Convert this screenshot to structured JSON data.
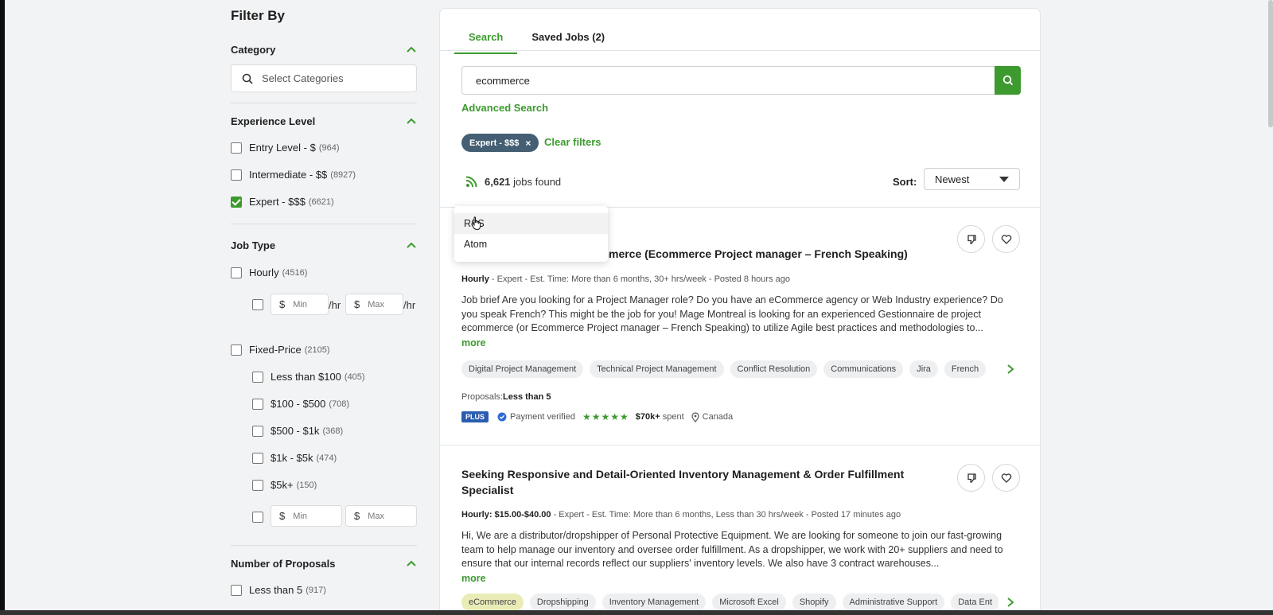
{
  "sidebar": {
    "title": "Filter By",
    "category": {
      "label": "Category",
      "placeholder": "Select Categories"
    },
    "experience": {
      "label": "Experience Level",
      "items": [
        {
          "label": "Entry Level - $",
          "count": "(964)",
          "checked": false
        },
        {
          "label": "Intermediate - $$",
          "count": "(8927)",
          "checked": false
        },
        {
          "label": "Expert - $$$",
          "count": "(6621)",
          "checked": true
        }
      ]
    },
    "job_type": {
      "label": "Job Type",
      "hourly": {
        "label": "Hourly",
        "count": "(4516)"
      },
      "rate_min_placeholder": "Min",
      "rate_max_placeholder": "Max",
      "per_hr": "/hr",
      "currency": "$",
      "fixed": {
        "label": "Fixed-Price",
        "count": "(2105)"
      },
      "fixed_items": [
        {
          "label": "Less than $100",
          "count": "(405)"
        },
        {
          "label": "$100 - $500",
          "count": "(708)"
        },
        {
          "label": "$500 - $1k",
          "count": "(368)"
        },
        {
          "label": "$1k - $5k",
          "count": "(474)"
        },
        {
          "label": "$5k+",
          "count": "(150)"
        }
      ]
    },
    "proposals": {
      "label": "Number of Proposals",
      "items": [
        {
          "label": "Less than 5",
          "count": "(917)"
        }
      ]
    }
  },
  "main": {
    "tabs": [
      {
        "label": "Search",
        "active": true
      },
      {
        "label": "Saved Jobs (2)",
        "active": false
      }
    ],
    "search_value": "ecommerce",
    "advanced_search": "Advanced Search",
    "active_filter": "Expert - $$$",
    "clear_filters": "Clear filters",
    "jobs_found_count": "6,621",
    "jobs_found_suffix": " jobs found",
    "sort_label": "Sort:",
    "sort_value": "Newest",
    "feed_menu": [
      "RSS",
      "Atom"
    ]
  },
  "jobs": [
    {
      "title_visible": "ommerce (Ecommerce Project manager – French Speaking)",
      "meta_type": "Hourly",
      "meta_rest": " - Expert - Est. Time: More than 6 months, 30+ hrs/week - Posted 8 hours ago",
      "desc": "Job brief Are you looking for a Project Manager role? Do you have an eCommerce agency or Web Industry experience? Do you speak French? This might be the job for you! Mage Montreal is looking for an experienced Gestionnaire de project ecommerce (or Ecommerce Project manager – French Speaking) to utilize Agile best practices and methodologies to...",
      "more": "more",
      "skills": [
        "Digital Project Management",
        "Technical Project Management",
        "Conflict Resolution",
        "Communications",
        "Jira",
        "French"
      ],
      "proposals_label": "Proposals: ",
      "proposals_value": "Less than 5",
      "plus": "PLUS",
      "payment": "Payment verified",
      "stars": "★★★★★",
      "spent_amount": "$70k+",
      "spent_suffix": " spent",
      "location": "Canada"
    },
    {
      "title": "Seeking Responsive and Detail-Oriented Inventory Management & Order Fulfillment Specialist",
      "meta_type": "Hourly: $15.00-$40.00",
      "meta_rest": " - Expert - Est. Time: More than 6 months, Less than 30 hrs/week - Posted 17 minutes ago",
      "desc": "Hi, We are a distributor/dropshipper of Personal Protective Equipment. We are looking for someone to join our fast-growing team to help manage our inventory and oversee order fulfillment. As a dropshipper, we work with 20+ suppliers and need to ensure that our internal records reflect our suppliers' inventory levels. We also have 3 contract warehouses...",
      "more": "more",
      "skills": [
        "eCommerce",
        "Dropshipping",
        "Inventory Management",
        "Microsoft Excel",
        "Shopify",
        "Administrative Support",
        "Data Ent"
      ]
    }
  ],
  "colors": {
    "accent": "#3d9a2f",
    "chip": "#445f73",
    "plus_badge": "#2a5db0"
  }
}
